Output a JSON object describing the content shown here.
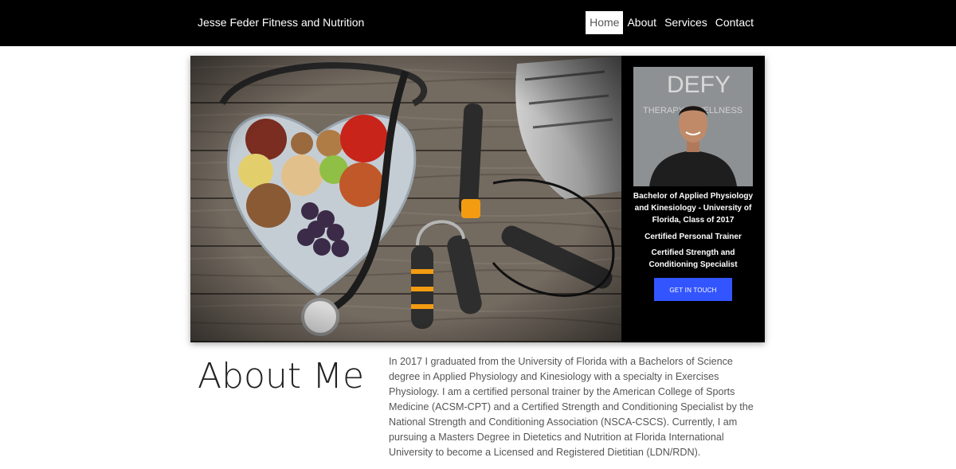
{
  "header": {
    "brand": "Jesse Feder Fitness and Nutrition",
    "nav": [
      {
        "label": "Home",
        "active": true
      },
      {
        "label": "About",
        "active": false
      },
      {
        "label": "Services",
        "active": false
      },
      {
        "label": "Contact",
        "active": false
      }
    ]
  },
  "hero": {
    "image_alt": "heart-shaped plate of healthy food with stethoscope, sneakers, jump rope and hand grippers",
    "portrait_sign_text": "DEFY THERAPY & WELLNESS",
    "credentials": [
      "Bachelor of Applied Physiology and Kinesiology - University of Florida, Class of 2017",
      "Certified Personal Trainer",
      "Certified Strength and Conditioning Specialist"
    ],
    "cta_label": "GET IN TOUCH"
  },
  "about": {
    "title": "About Me",
    "body": "In 2017 I graduated from the University of Florida with a Bachelors of Science degree in Applied Physiology and Kinesiology with a specialty in Exercises Physiology. I am a certified personal trainer by the American College of Sports Medicine (ACSM-CPT) and a Certified Strength and Conditioning Specialist by the National Strength and Conditioning Association (NSCA-CSCS). Currently, I am pursuing a Masters Degree in Dietetics and Nutrition at Florida International University to become a Licensed and Registered Dietitian (LDN/RDN)."
  },
  "colors": {
    "header_bg": "#000000",
    "cta_bg": "#3355ff",
    "body_text": "#555555"
  }
}
